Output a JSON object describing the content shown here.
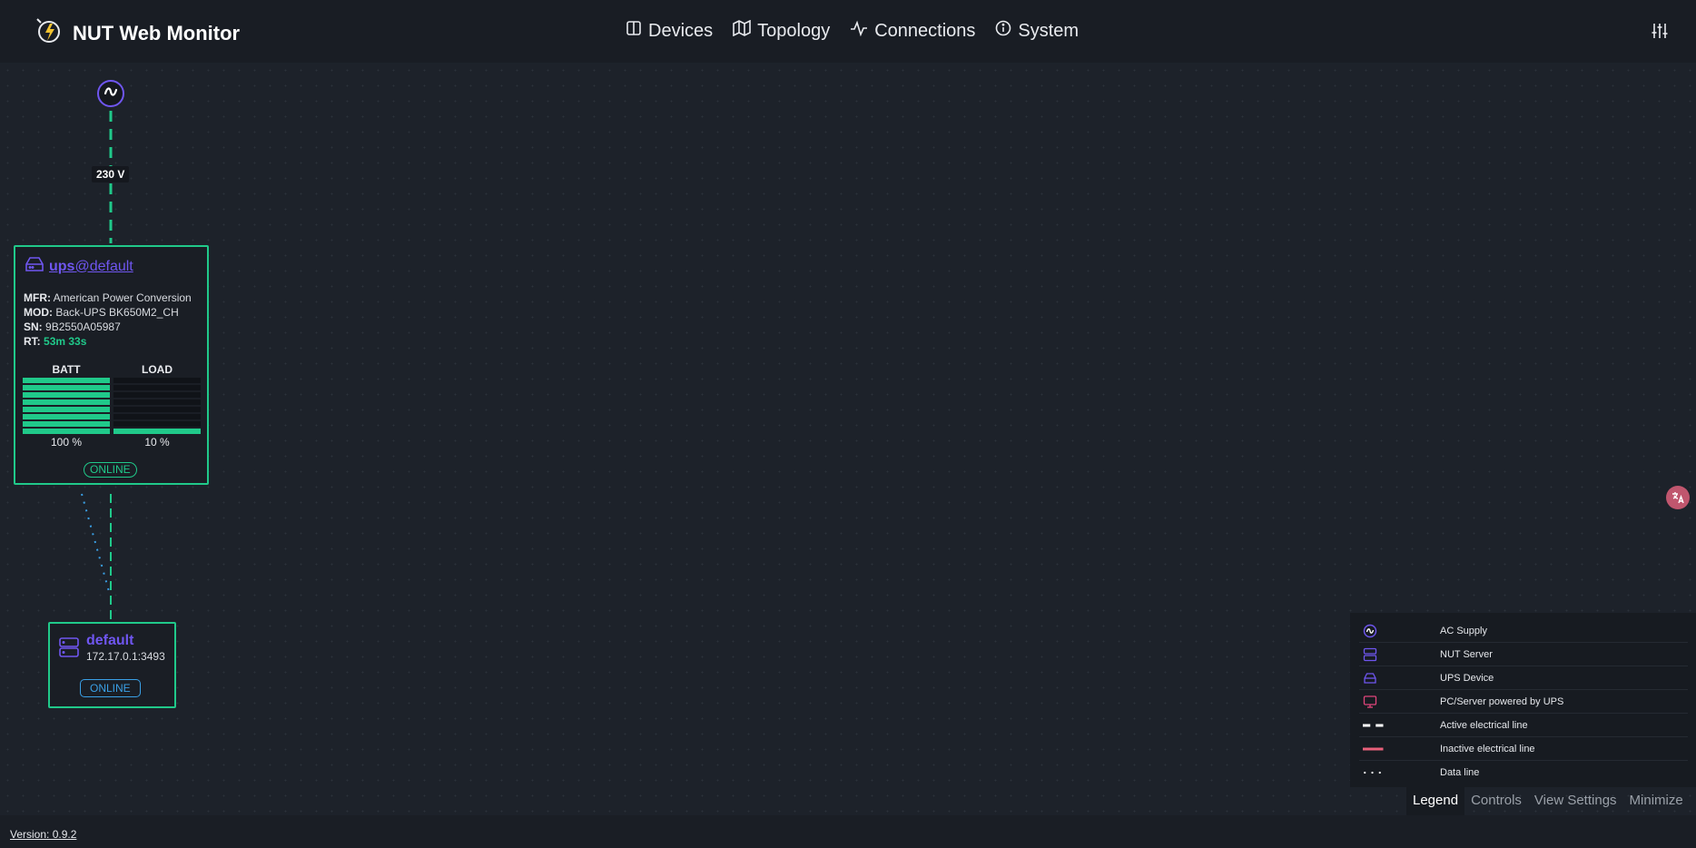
{
  "app": {
    "brand": "NUT Web Monitor",
    "version_label": "Version: 0.9.2"
  },
  "nav": {
    "items": [
      {
        "label": "Devices",
        "icon": "book-open-icon"
      },
      {
        "label": "Topology",
        "icon": "map-icon"
      },
      {
        "label": "Connections",
        "icon": "activity-icon"
      },
      {
        "label": "System",
        "icon": "info-icon"
      }
    ]
  },
  "ac_supply": {
    "voltage": "230 V"
  },
  "ups": {
    "name": "ups",
    "server_suffix": "@default",
    "mfr_label": "MFR:",
    "mfr": "American Power Conversion",
    "mod_label": "MOD:",
    "mod": "Back-UPS BK650M2_CH",
    "sn_label": "SN:",
    "sn": "9B2550A05987",
    "rt_label": "RT:",
    "rt": "53m 33s",
    "batt_label": "BATT",
    "load_label": "LOAD",
    "batt_pct": "100 %",
    "load_pct": "10 %",
    "batt_level": 1.0,
    "load_level": 0.1,
    "status": "ONLINE"
  },
  "server": {
    "name": "default",
    "address": "172.17.0.1:3493",
    "status": "ONLINE"
  },
  "legend": {
    "items": [
      {
        "label": "AC Supply",
        "icon": "ac-supply-icon"
      },
      {
        "label": "NUT Server",
        "icon": "server-icon"
      },
      {
        "label": "UPS Device",
        "icon": "ups-icon"
      },
      {
        "label": "PC/Server powered by UPS",
        "icon": "monitor-icon"
      },
      {
        "label": "Active electrical line",
        "icon": "dashed-line"
      },
      {
        "label": "Inactive electrical line",
        "icon": "solid-line"
      },
      {
        "label": "Data line",
        "icon": "dotted-line"
      }
    ],
    "tabs": [
      {
        "label": "Legend",
        "active": true
      },
      {
        "label": "Controls",
        "active": false
      },
      {
        "label": "View Settings",
        "active": false
      },
      {
        "label": "Minimize",
        "active": false
      }
    ]
  },
  "colors": {
    "accent_purple": "#6f56f0",
    "online_green": "#20c98a",
    "data_blue": "#3aa0e6",
    "pc_pink": "#e0457b",
    "inactive_red": "#e8607a"
  }
}
